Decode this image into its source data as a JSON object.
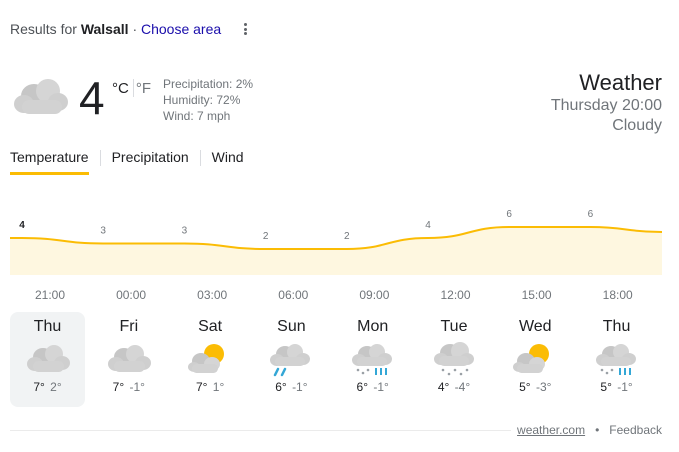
{
  "header": {
    "results_for": "Results for",
    "location": "Walsall",
    "sep": "·",
    "choose_area": "Choose area"
  },
  "current": {
    "temp": "4",
    "unit_c": "°C",
    "unit_f": "°F",
    "precipitation": "Precipitation: 2%",
    "humidity": "Humidity: 72%",
    "wind": "Wind: 7 mph",
    "icon": "cloud-icon"
  },
  "summary": {
    "title": "Weather",
    "time": "Thursday 20:00",
    "condition": "Cloudy"
  },
  "tabs": [
    "Temperature",
    "Precipitation",
    "Wind"
  ],
  "chart_data": {
    "type": "area",
    "x": [
      "21:00",
      "00:00",
      "03:00",
      "06:00",
      "09:00",
      "12:00",
      "15:00",
      "18:00"
    ],
    "values": [
      4,
      3,
      3,
      2,
      2,
      4,
      6,
      6
    ],
    "labels": [
      "4",
      "3",
      "3",
      "2",
      "2",
      "4",
      "6",
      "6"
    ],
    "ylim": [
      0,
      8
    ],
    "line_color": "#fbbc04",
    "fill_color": "#fef7e0"
  },
  "days": [
    {
      "name": "Thu",
      "hi": "7°",
      "lo": "2°",
      "icon": "cloud-icon"
    },
    {
      "name": "Fri",
      "hi": "7°",
      "lo": "-1°",
      "icon": "cloud-icon"
    },
    {
      "name": "Sat",
      "hi": "7°",
      "lo": "1°",
      "icon": "partly-cloudy-icon"
    },
    {
      "name": "Sun",
      "hi": "6°",
      "lo": "-1°",
      "icon": "showers-icon"
    },
    {
      "name": "Mon",
      "hi": "6°",
      "lo": "-1°",
      "icon": "snow-showers-icon"
    },
    {
      "name": "Tue",
      "hi": "4°",
      "lo": "-4°",
      "icon": "snow-icon"
    },
    {
      "name": "Wed",
      "hi": "5°",
      "lo": "-3°",
      "icon": "partly-cloudy-icon"
    },
    {
      "name": "Thu",
      "hi": "5°",
      "lo": "-1°",
      "icon": "snow-showers-icon"
    }
  ],
  "footer": {
    "source": "weather.com",
    "dot": "•",
    "feedback": "Feedback"
  }
}
